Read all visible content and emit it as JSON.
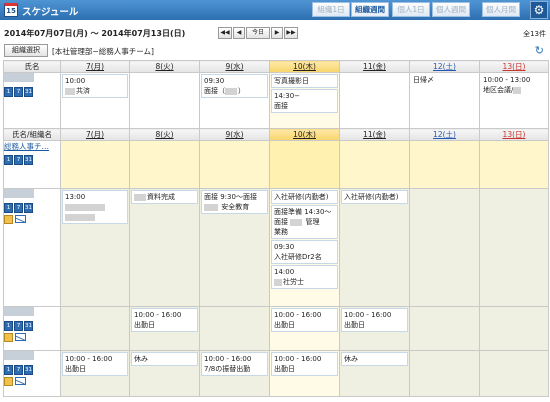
{
  "app": {
    "calendar_icon_text": "15",
    "title": "スケジュール"
  },
  "view_tabs": [
    {
      "label": "組織1日",
      "active": false
    },
    {
      "label": "組織週間",
      "active": true
    },
    {
      "label": "個人1日",
      "active": false
    },
    {
      "label": "個人週間",
      "active": false
    },
    {
      "label": "個人月間",
      "active": false
    }
  ],
  "settings_icon": "gear-icon",
  "toolbar": {
    "date_range": "2014年07月07日(月) 〜 2014年07月13日(日)",
    "nav": [
      "◀◀",
      "◀",
      "今日",
      "▶",
      "▶▶"
    ],
    "count": "全13件"
  },
  "org": {
    "select_label": "組織選択",
    "current": "[本社管理部−総務人事チーム]"
  },
  "header1": {
    "first": "氏名"
  },
  "header2": {
    "first": "氏名/組織名"
  },
  "days": [
    "7(月)",
    "8(火)",
    "9(水)",
    "10(木)",
    "11(金)",
    "12(土)",
    "13(日)"
  ],
  "org_row": {
    "name": "総務人事チ…"
  },
  "icon_labels": {
    "day": "1",
    "week": "7",
    "month": "31"
  },
  "user1": {
    "cells": [
      [
        "10:00",
        "共済"
      ],
      [],
      [
        "09:30",
        "面接（"
      ],
      [
        "写真撮影日",
        "14:30−",
        "面接"
      ],
      [],
      [
        "日帰〆"
      ],
      [
        "10:00 - 13:00",
        "地区会議/"
      ]
    ]
  },
  "user2": {
    "cells": [
      [
        "13:00"
      ],
      [
        "資料完成"
      ],
      [
        "面接 9:30〜面接",
        "安全教育"
      ],
      [
        "入社研修(内勤者)",
        "面接準備 14:30〜",
        "面接",
        "管理",
        "業務",
        "09:30",
        "入社研修Dr2名",
        "14:00",
        "社労士"
      ],
      [
        "入社研修(内勤者)"
      ],
      [],
      []
    ]
  },
  "user3": {
    "cells": [
      [],
      [
        "10:00 - 16:00",
        "出勤日"
      ],
      [],
      [
        "10:00 - 16:00",
        "出勤日"
      ],
      [
        "10:00 - 16:00",
        "出勤日"
      ],
      [],
      []
    ]
  },
  "user4": {
    "cells": [
      [
        "10:00 - 16:00",
        "出勤日"
      ],
      [
        "休み"
      ],
      [
        "10:00 - 16:00",
        "7/8の振替出勤"
      ],
      [
        "10:00 - 16:00",
        "出勤日"
      ],
      [
        "休み"
      ],
      [],
      []
    ]
  }
}
